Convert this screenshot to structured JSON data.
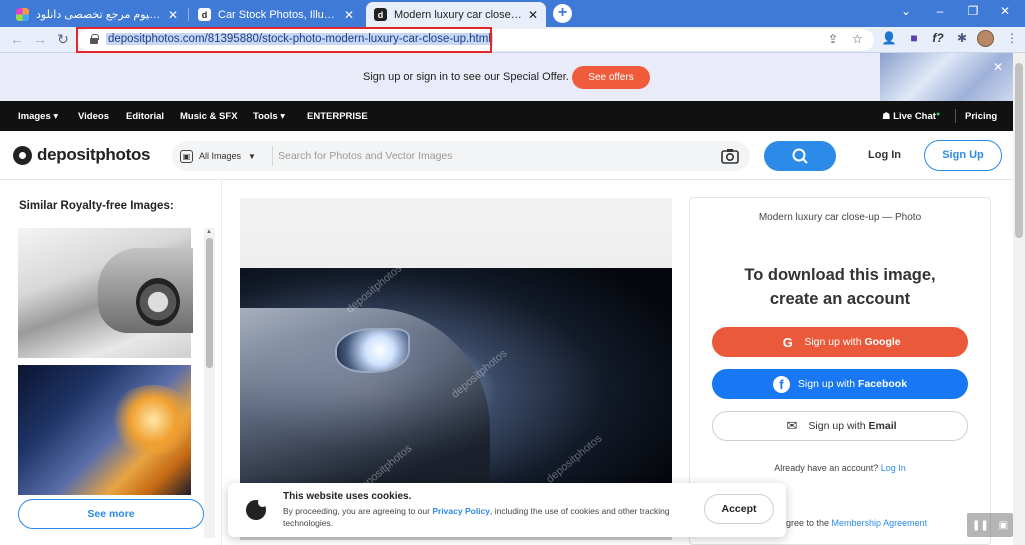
{
  "browser": {
    "tabs": [
      {
        "title": "دانلود پریمیوم مرجع تخصصی دانلود",
        "favicon": "colorful-circle-icon",
        "active": false
      },
      {
        "title": "Car Stock Photos, Illustrations and",
        "favicon": "depositphotos-icon",
        "active": false
      },
      {
        "title": "Modern luxury car close-up Stock",
        "favicon": "depositphotos-icon",
        "active": true
      }
    ],
    "new_tab_label": "+",
    "url": "depositphotos.com/81395880/stock-photo-modern-luxury-car-close-up.html"
  },
  "promo": {
    "text": "Sign up or sign in to see our Special Offer.",
    "cta": "See offers"
  },
  "nav": {
    "items": [
      "Images",
      "Videos",
      "Editorial",
      "Music & SFX",
      "Tools",
      "ENTERPRISE"
    ],
    "live_chat": "Live Chat",
    "pricing": "Pricing"
  },
  "header": {
    "logo": "depositphotos",
    "filter_label": "All Images",
    "search_placeholder": "Search for Photos and Vector Images",
    "login": "Log In",
    "signup": "Sign Up"
  },
  "sidebar": {
    "title": "Similar Royalty-free Images:",
    "see_more": "See more"
  },
  "main_image": {
    "watermark": "depositphotos"
  },
  "signup_panel": {
    "caption": "Modern luxury car close-up — Photo",
    "heading_line1": "To download this image,",
    "heading_line2": "create an account",
    "google_prefix": "Sign up with ",
    "google_brand": "Google",
    "facebook_prefix": "Sign up with ",
    "facebook_brand": "Facebook",
    "email_prefix": "Sign up with ",
    "email_brand": "Email",
    "already_text": "Already have an account?",
    "already_link": "Log In",
    "agree_text": "gree to the",
    "agree_link": "Membership Agreement"
  },
  "cookie": {
    "title": "This website uses cookies.",
    "text_before": "By proceeding, you are agreeing to our",
    "link": "Privacy Policy",
    "text_after": ", including the use of cookies and other tracking technologies.",
    "accept": "Accept"
  },
  "colors": {
    "accent": "#2c8ae8",
    "cta_orange": "#f05c3b",
    "google": "#ea5a3a",
    "facebook": "#1877f2",
    "tabstrip": "#3f7ad6",
    "url_highlight_box": "#e0282a"
  }
}
